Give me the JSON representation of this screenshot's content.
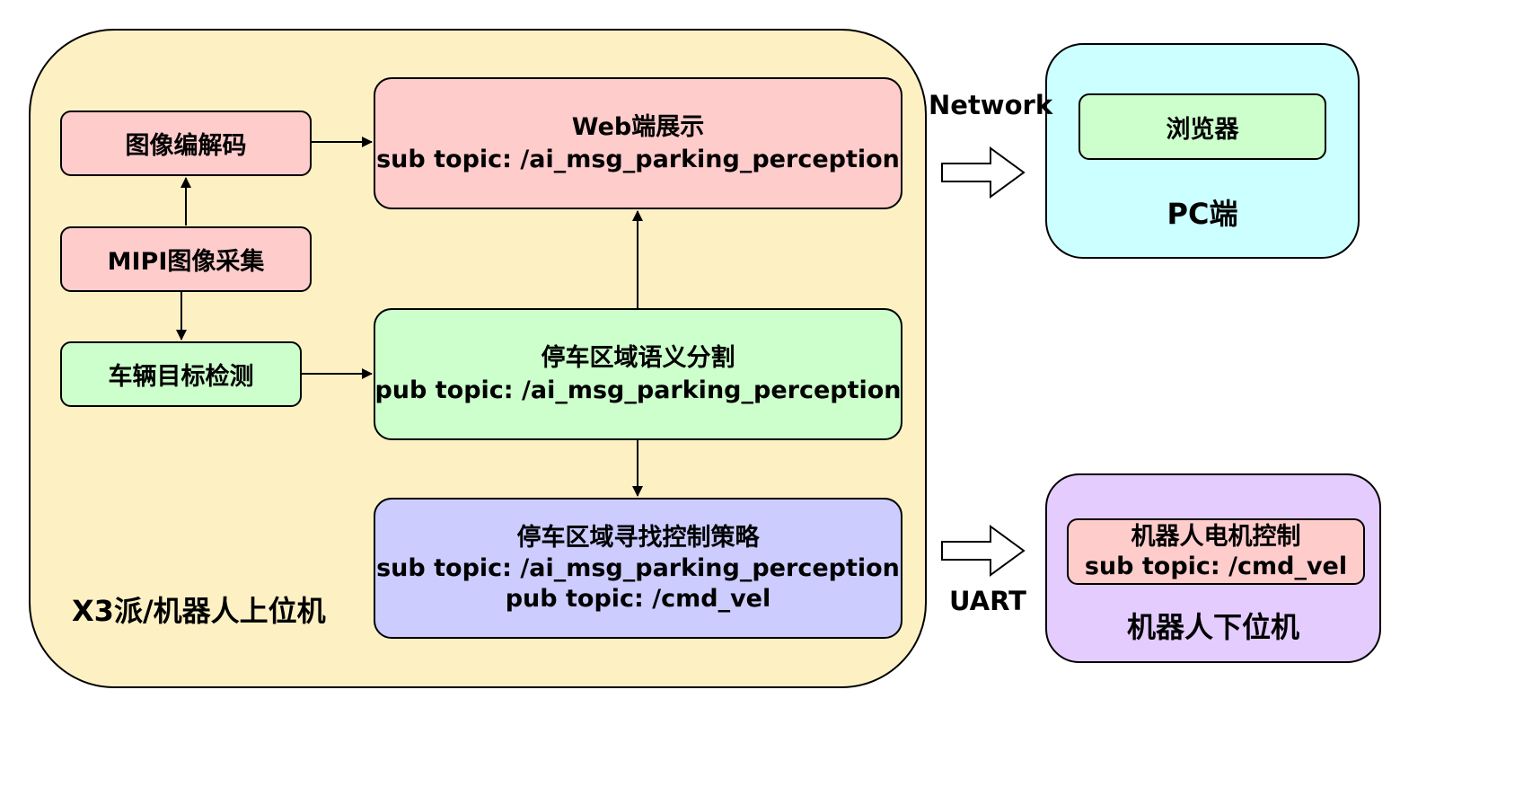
{
  "colors": {
    "host_bg": "#fdf1c4",
    "pc_bg": "#ccffff",
    "lower_bg": "#e5ccff",
    "red_node": "#ffcccc",
    "green_node": "#ccffcc",
    "blue_node": "#ccccff",
    "stroke": "#000000"
  },
  "host": {
    "label": "X3派/机器人上位机"
  },
  "nodes": {
    "codec": {
      "label": "图像编解码"
    },
    "mipi": {
      "label": "MIPI图像采集"
    },
    "vehicle": {
      "label": "车辆目标检测"
    },
    "web": {
      "line1": "Web端展示",
      "line2": "sub topic: /ai_msg_parking_perception"
    },
    "seg": {
      "line1": "停车区域语义分割",
      "line2": "pub topic: /ai_msg_parking_perception"
    },
    "strategy": {
      "line1": "停车区域寻找控制策略",
      "line2": "sub topic: /ai_msg_parking_perception",
      "line3": "pub topic: /cmd_vel"
    }
  },
  "pc": {
    "label": "PC端",
    "browser": "浏览器"
  },
  "lower": {
    "label": "机器人下位机",
    "motor_line1": "机器人电机控制",
    "motor_line2": "sub topic: /cmd_vel"
  },
  "links": {
    "network": "Network",
    "uart": "UART"
  }
}
